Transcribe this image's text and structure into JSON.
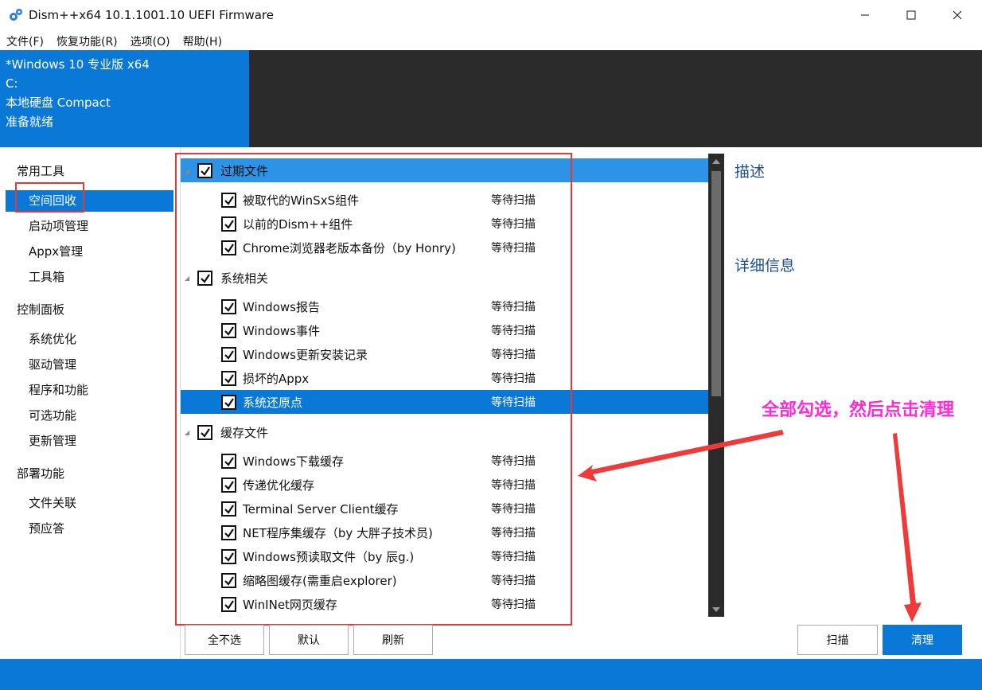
{
  "window": {
    "title": "Dism++x64 10.1.1001.10 UEFI Firmware",
    "icon": "gear-icon"
  },
  "menubar": [
    "文件(F)",
    "恢复功能(R)",
    "选项(O)",
    "帮助(H)"
  ],
  "info": {
    "lines": [
      "*Windows 10 专业版 x64",
      "C:",
      "本地硬盘 Compact",
      "准备就绪"
    ]
  },
  "nav": {
    "groups": [
      {
        "label": "常用工具",
        "items": [
          "空间回收",
          "启动项管理",
          "Appx管理",
          "工具箱"
        ]
      },
      {
        "label": "控制面板",
        "items": [
          "系统优化",
          "驱动管理",
          "程序和功能",
          "可选功能",
          "更新管理"
        ]
      },
      {
        "label": "部署功能",
        "items": [
          "文件关联",
          "预应答"
        ]
      }
    ],
    "active": "空间回收"
  },
  "list": {
    "groups": [
      {
        "label": "过期文件",
        "checked": true,
        "items": [
          {
            "label": "被取代的WinSxS组件",
            "status": "等待扫描",
            "checked": true
          },
          {
            "label": "以前的Dism++组件",
            "status": "等待扫描",
            "checked": true
          },
          {
            "label": "Chrome浏览器老版本备份（by Honry)",
            "status": "等待扫描",
            "checked": true
          }
        ]
      },
      {
        "label": "系统相关",
        "checked": true,
        "items": [
          {
            "label": "Windows报告",
            "status": "等待扫描",
            "checked": true
          },
          {
            "label": "Windows事件",
            "status": "等待扫描",
            "checked": true
          },
          {
            "label": "Windows更新安装记录",
            "status": "等待扫描",
            "checked": true
          },
          {
            "label": "损坏的Appx",
            "status": "等待扫描",
            "checked": true
          },
          {
            "label": "系统还原点",
            "status": "等待扫描",
            "checked": true
          }
        ]
      },
      {
        "label": "缓存文件",
        "checked": true,
        "items": [
          {
            "label": "Windows下载缓存",
            "status": "等待扫描",
            "checked": true
          },
          {
            "label": "传递优化缓存",
            "status": "等待扫描",
            "checked": true
          },
          {
            "label": "Terminal Server Client缓存",
            "status": "等待扫描",
            "checked": true
          },
          {
            "label": "NET程序集缓存（by 大胖子技术员)",
            "status": "等待扫描",
            "checked": true
          },
          {
            "label": "Windows预读取文件（by 辰g.)",
            "status": "等待扫描",
            "checked": true
          },
          {
            "label": "缩略图缓存(需重启explorer)",
            "status": "等待扫描",
            "checked": true
          },
          {
            "label": "WinINet网页缓存",
            "status": "等待扫描",
            "checked": true
          }
        ]
      }
    ],
    "selected_item": "系统还原点",
    "highlighted_group": "过期文件"
  },
  "right": {
    "description_title": "描述",
    "details_title": "详细信息"
  },
  "buttons": {
    "select_none": "全不选",
    "default": "默认",
    "refresh": "刷新",
    "scan": "扫描",
    "clean": "清理"
  },
  "annotation": {
    "text": "全部勾选，然后点击清理",
    "color": "#ff2ad4"
  },
  "colors": {
    "accent": "#0a78d7",
    "dark_panel": "#2b2b2b",
    "highlight_box": "#e53935"
  }
}
